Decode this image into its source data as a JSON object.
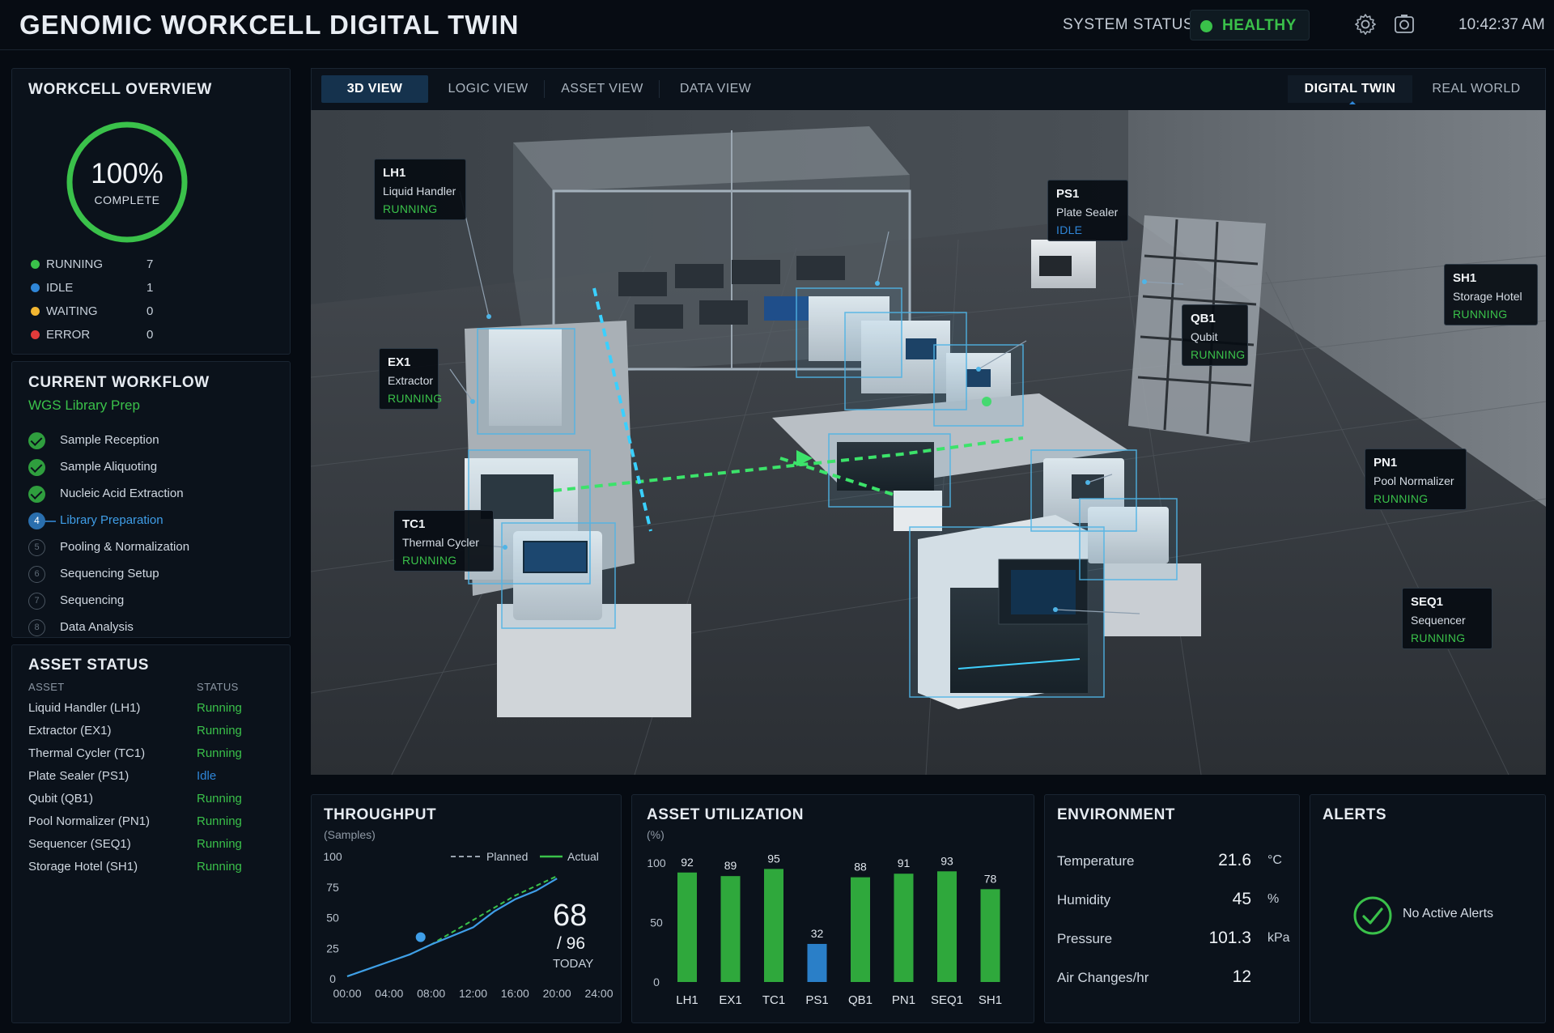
{
  "header": {
    "title": "GENOMIC WORKCELL DIGITAL TWIN",
    "system_status_label": "SYSTEM STATUS",
    "system_status_value": "HEALTHY",
    "time": "10:42:37 AM",
    "icons": [
      "gear-icon",
      "camera-icon"
    ]
  },
  "overview": {
    "title": "WORKCELL OVERVIEW",
    "percent": "100%",
    "percent_value": 1.0,
    "percent_label": "COMPLETE",
    "stats": [
      {
        "label": "RUNNING",
        "value": "7",
        "color": "#3ac14a"
      },
      {
        "label": "IDLE",
        "value": "1",
        "color": "#2f86d8"
      },
      {
        "label": "WAITING",
        "value": "0",
        "color": "#f2b631"
      },
      {
        "label": "ERROR",
        "value": "0",
        "color": "#e23b3b"
      }
    ]
  },
  "workflow": {
    "title": "CURRENT WORKFLOW",
    "name": "WGS Library Prep",
    "steps": [
      {
        "label": "Sample Reception",
        "state": "done",
        "num": "1"
      },
      {
        "label": "Sample Aliquoting",
        "state": "done",
        "num": "2"
      },
      {
        "label": "Nucleic Acid Extraction",
        "state": "done",
        "num": "3"
      },
      {
        "label": "Library Preparation",
        "state": "active",
        "num": "4"
      },
      {
        "label": "Pooling & Normalization",
        "state": "pending",
        "num": "5"
      },
      {
        "label": "Sequencing Setup",
        "state": "pending",
        "num": "6"
      },
      {
        "label": "Sequencing",
        "state": "pending",
        "num": "7"
      },
      {
        "label": "Data Analysis",
        "state": "pending",
        "num": "8"
      }
    ]
  },
  "asset_status": {
    "title": "ASSET STATUS",
    "col_asset": "ASSET",
    "col_status": "STATUS",
    "rows": [
      {
        "asset": "Liquid Handler (LH1)",
        "status": "Running"
      },
      {
        "asset": "Extractor (EX1)",
        "status": "Running"
      },
      {
        "asset": "Thermal Cycler (TC1)",
        "status": "Running"
      },
      {
        "asset": "Plate Sealer (PS1)",
        "status": "Idle"
      },
      {
        "asset": "Qubit (QB1)",
        "status": "Running"
      },
      {
        "asset": "Pool Normalizer (PN1)",
        "status": "Running"
      },
      {
        "asset": "Sequencer (SEQ1)",
        "status": "Running"
      },
      {
        "asset": "Storage Hotel (SH1)",
        "status": "Running"
      }
    ]
  },
  "tabs": {
    "views": [
      "3D VIEW",
      "LOGIC VIEW",
      "ASSET VIEW",
      "DATA VIEW"
    ],
    "active_view": "3D VIEW",
    "modes": [
      "DIGITAL TWIN",
      "REAL WORLD"
    ],
    "active_mode": "DIGITAL TWIN"
  },
  "callouts": [
    {
      "id": "LH1",
      "name": "Liquid Handler",
      "status": "RUNNING"
    },
    {
      "id": "PS1",
      "name": "Plate Sealer",
      "status": "IDLE"
    },
    {
      "id": "SH1",
      "name": "Storage Hotel",
      "status": "RUNNING"
    },
    {
      "id": "QB1",
      "name": "Qubit",
      "status": "RUNNING"
    },
    {
      "id": "EX1",
      "name": "Extractor",
      "status": "RUNNING"
    },
    {
      "id": "PN1",
      "name": "Pool Normalizer",
      "status": "RUNNING"
    },
    {
      "id": "TC1",
      "name": "Thermal Cycler",
      "status": "RUNNING"
    },
    {
      "id": "SEQ1",
      "name": "Sequencer",
      "status": "RUNNING"
    }
  ],
  "throughput": {
    "title": "THROUGHPUT",
    "unit": "(Samples)",
    "current": "68",
    "total": "/ 96",
    "period": "TODAY",
    "chart_data": {
      "type": "line",
      "title": "THROUGHPUT",
      "ylabel": "(Samples)",
      "x_ticks": [
        "00:00",
        "04:00",
        "08:00",
        "12:00",
        "16:00",
        "20:00",
        "24:00"
      ],
      "y_ticks": [
        "100",
        "75",
        "50",
        "25",
        "0"
      ],
      "ylim": [
        0,
        100
      ],
      "xlim": [
        0,
        24
      ],
      "series": [
        {
          "name": "Planned",
          "style": "dashed",
          "color": "#3ac14a",
          "x": [
            0,
            2,
            4,
            6,
            8,
            10,
            12,
            14,
            16,
            18,
            20
          ],
          "y": [
            2,
            8,
            14,
            20,
            28,
            38,
            48,
            58,
            68,
            76,
            84
          ]
        },
        {
          "name": "Actual",
          "style": "solid",
          "color": "#3ac14a",
          "x": [
            0,
            2,
            4,
            6,
            8,
            10,
            12,
            14,
            16,
            18,
            20
          ],
          "y": [
            2,
            8,
            14,
            20,
            28,
            35,
            42,
            55,
            65,
            72,
            82
          ]
        }
      ],
      "marker": {
        "x": 7,
        "y": 34
      }
    }
  },
  "utilization": {
    "title": "ASSET UTILIZATION",
    "unit": "(%)",
    "chart_data": {
      "type": "bar",
      "title": "ASSET UTILIZATION",
      "ylabel": "(%)",
      "categories": [
        "LH1",
        "EX1",
        "TC1",
        "PS1",
        "QB1",
        "PN1",
        "SEQ1",
        "SH1"
      ],
      "values": [
        92,
        89,
        95,
        32,
        88,
        91,
        93,
        78
      ],
      "labels": [
        "92",
        "89",
        "95",
        "32",
        "88",
        "91",
        "93",
        "78"
      ],
      "colors": [
        "#2fa83c",
        "#2fa83c",
        "#2fa83c",
        "#2a7fc8",
        "#2fa83c",
        "#2fa83c",
        "#2fa83c",
        "#2fa83c"
      ],
      "y_ticks": [
        "100",
        "50",
        "0"
      ],
      "ylim": [
        0,
        100
      ]
    }
  },
  "environment": {
    "title": "ENVIRONMENT",
    "rows": [
      {
        "label": "Temperature",
        "value": "21.6",
        "unit": "°C"
      },
      {
        "label": "Humidity",
        "value": "45",
        "unit": "%"
      },
      {
        "label": "Pressure",
        "value": "101.3",
        "unit": "kPa"
      },
      {
        "label": "Air Changes/hr",
        "value": "12",
        "unit": ""
      }
    ]
  },
  "alerts": {
    "title": "ALERTS",
    "message": "No Active Alerts"
  },
  "colors": {
    "running": "#3ac14a",
    "idle": "#2f86d8",
    "accent": "#2f86d8"
  }
}
